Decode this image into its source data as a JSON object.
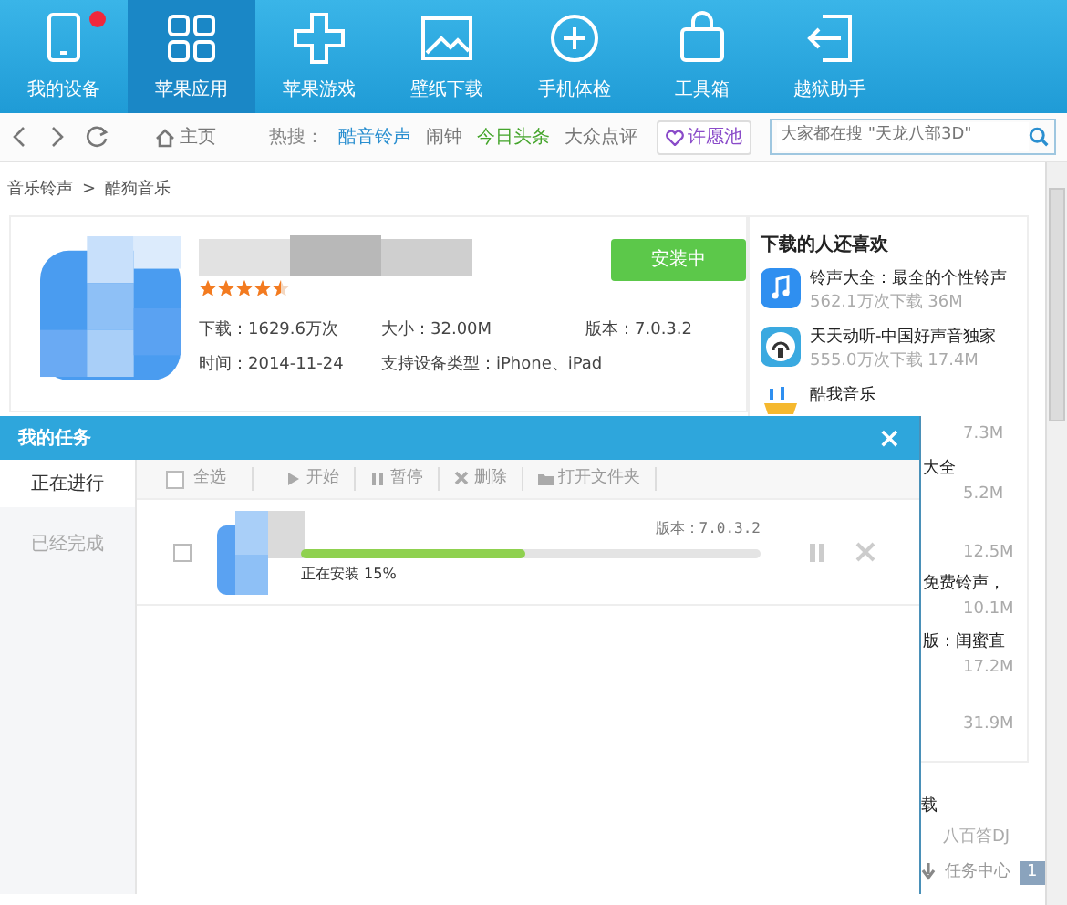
{
  "nav_tabs": [
    {
      "label": "我的设备",
      "selected": false,
      "notification": true
    },
    {
      "label": "苹果应用",
      "selected": true,
      "notification": false
    },
    {
      "label": "苹果游戏",
      "selected": false,
      "notification": false
    },
    {
      "label": "壁纸下载",
      "selected": false,
      "notification": false
    },
    {
      "label": "手机体检",
      "selected": false,
      "notification": false
    },
    {
      "label": "工具箱",
      "selected": false,
      "notification": false
    },
    {
      "label": "越狱助手",
      "selected": false,
      "notification": false
    }
  ],
  "toolbar": {
    "home": "主页",
    "hot_label": "热搜：",
    "hot_links": [
      {
        "text": "酷音铃声",
        "color": "#2a8fd0"
      },
      {
        "text": "闹钟",
        "color": "#777777"
      },
      {
        "text": "今日头条",
        "color": "#45a52c"
      },
      {
        "text": "大众点评",
        "color": "#777777"
      }
    ],
    "wish_button": "许愿池",
    "search": {
      "placeholder": "大家都在搜 \"天龙八部3D\""
    }
  },
  "breadcrumb": {
    "items": [
      "音乐铃声",
      "酷狗音乐"
    ],
    "separator": ">"
  },
  "app": {
    "stars": 4.5,
    "install_button": "安装中",
    "details": [
      "下载：1629.6万次",
      "大小：32.00M",
      "版本：7.0.3.2",
      "时间：2014-11-24",
      "支持设备类型：iPhone、iPad"
    ]
  },
  "sidebar": {
    "title": "下载的人还喜欢",
    "items": [
      {
        "kind": "full",
        "title": "铃声大全：最全的个性铃声",
        "downloads": "562.1万次下载",
        "size": "36M"
      },
      {
        "kind": "full",
        "title": "天天动听-中国好声音独家",
        "downloads": "555.0万次下载",
        "size": "17.4M"
      },
      {
        "kind": "cut",
        "title": "酷我音乐",
        "size": "7.3M"
      },
      {
        "kind": "partial",
        "title": "大全",
        "size": "5.2M"
      },
      {
        "kind": "partial",
        "size": "12.5M"
      },
      {
        "kind": "partial",
        "title": "免费铃声，",
        "size": "10.1M"
      },
      {
        "kind": "partial",
        "title": "版：闺蜜直",
        "size": "17.2M"
      },
      {
        "kind": "partial",
        "size": "31.9M"
      }
    ],
    "more": {
      "title": "载",
      "text": "八百答DJ"
    },
    "task_center": {
      "label": "任务中心",
      "count": "1"
    }
  },
  "dialog": {
    "title": "我的任务",
    "close": "×",
    "tabs": [
      {
        "label": "正在进行",
        "selected": true
      },
      {
        "label": "已经完成",
        "selected": false
      }
    ],
    "select_all": {
      "label": "全选",
      "checked": false
    },
    "actions": [
      {
        "label": "开始"
      },
      {
        "label": "暂停"
      },
      {
        "label": "删除"
      },
      {
        "label": "打开文件夹"
      }
    ],
    "tasks": [
      {
        "checked": false,
        "version": "版本：7.0.3.2",
        "level": 0.49,
        "status": "正在安装 15%"
      }
    ]
  }
}
